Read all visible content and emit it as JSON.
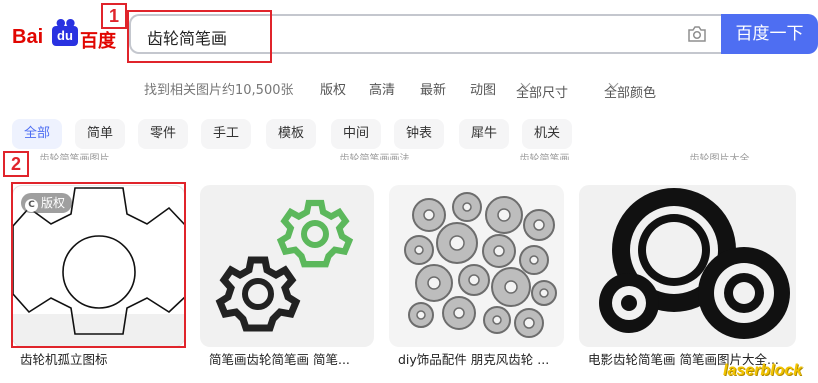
{
  "logo": {
    "bai": "Bai",
    "du": "du",
    "cn": "百度"
  },
  "search": {
    "query": "齿轮简笔画",
    "button": "百度一下"
  },
  "filters": {
    "count": "找到相关图片约10,500张",
    "items": [
      "版权",
      "高清",
      "最新",
      "动图",
      "全部尺寸",
      "全部颜色"
    ]
  },
  "tags": [
    "全部",
    "简单",
    "零件",
    "手工",
    "模板",
    "中间",
    "钟表",
    "犀牛",
    "机关"
  ],
  "faded": [
    "...齿轮简笔画图片...",
    "...齿轮简笔画画法...",
    "...齿轮简笔画...",
    "...齿轮图片大全..."
  ],
  "results": [
    {
      "badge": "版权",
      "caption": "齿轮机孤立图标"
    },
    {
      "caption": "简笔画齿轮简笔画 简笔..."
    },
    {
      "caption": "diy饰品配件 朋克风齿轮 ..."
    },
    {
      "caption": "电影齿轮简笔画 简笔画图片大全..."
    }
  ],
  "annotations": [
    "1",
    "2"
  ],
  "watermark": "laserblock",
  "colors": {
    "accent": "#4e6ef2",
    "annotation": "#e0242b",
    "brand_red": "#e10601",
    "gear_green": "#5cb85c"
  }
}
